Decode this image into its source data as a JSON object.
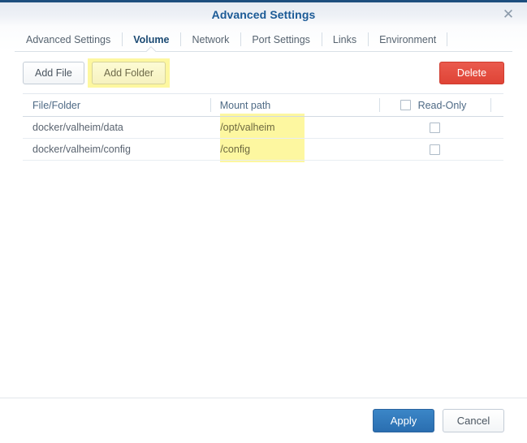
{
  "window": {
    "title": "Advanced Settings",
    "close_icon": "close-icon",
    "close_glyph": "✕"
  },
  "tabs": [
    {
      "label": "Advanced Settings",
      "active": false
    },
    {
      "label": "Volume",
      "active": true
    },
    {
      "label": "Network",
      "active": false
    },
    {
      "label": "Port Settings",
      "active": false
    },
    {
      "label": "Links",
      "active": false
    },
    {
      "label": "Environment",
      "active": false
    }
  ],
  "toolbar": {
    "add_file_label": "Add File",
    "add_folder_label": "Add Folder",
    "delete_label": "Delete"
  },
  "table": {
    "columns": [
      "File/Folder",
      "Mount path",
      "Read-Only"
    ],
    "header_select_all_checked": false,
    "rows": [
      {
        "file": "docker/valheim/data",
        "mount": "/opt/valheim",
        "read_only": false
      },
      {
        "file": "docker/valheim/config",
        "mount": "/config",
        "read_only": false
      }
    ]
  },
  "footer": {
    "apply_label": "Apply",
    "cancel_label": "Cancel"
  },
  "colors": {
    "title_blue": "#1b5a96",
    "accent_blue": "#2a6eb0",
    "danger_red": "#df4436",
    "highlight_yellow": "#fdf7a0",
    "top_border": "#1d4e7e"
  }
}
